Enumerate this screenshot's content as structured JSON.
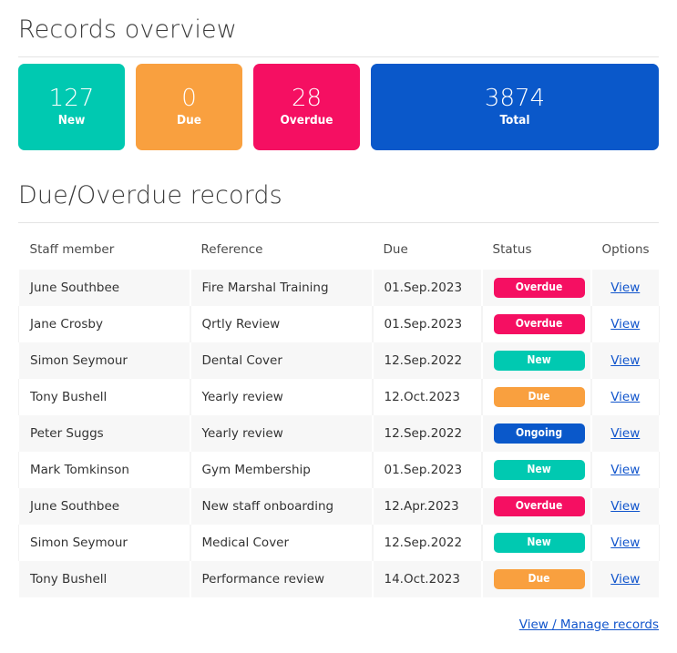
{
  "overview": {
    "title": "Records overview",
    "cards": [
      {
        "value": "127",
        "label": "New",
        "color": "#00c9b1",
        "size": "small"
      },
      {
        "value": "0",
        "label": "Due",
        "color": "#f9a03f",
        "size": "small"
      },
      {
        "value": "28",
        "label": "Overdue",
        "color": "#f50f62",
        "size": "small"
      },
      {
        "value": "3874",
        "label": "Total",
        "color": "#0a58ca",
        "size": "wide"
      }
    ]
  },
  "records_section": {
    "title": "Due/Overdue records",
    "columns": [
      "Staff member",
      "Reference",
      "Due",
      "Status",
      "Options"
    ],
    "action_label": "View",
    "rows": [
      {
        "staff": "June Southbee",
        "reference": "Fire Marshal Training",
        "due": "01.Sep.2023",
        "status": "Overdue",
        "status_color": "#f50f62",
        "action": "View"
      },
      {
        "staff": "Jane Crosby",
        "reference": "Qrtly Review",
        "due": "01.Sep.2023",
        "status": "Overdue",
        "status_color": "#f50f62",
        "action": "View"
      },
      {
        "staff": "Simon Seymour",
        "reference": "Dental Cover",
        "due": "12.Sep.2022",
        "status": "New",
        "status_color": "#00c9b1",
        "action": "View"
      },
      {
        "staff": "Tony Bushell",
        "reference": "Yearly review",
        "due": "12.Oct.2023",
        "status": "Due",
        "status_color": "#f9a03f",
        "action": "View"
      },
      {
        "staff": "Peter Suggs",
        "reference": "Yearly review",
        "due": "12.Sep.2022",
        "status": "Ongoing",
        "status_color": "#0a58ca",
        "action": "View"
      },
      {
        "staff": "Mark Tomkinson",
        "reference": "Gym Membership",
        "due": "01.Sep.2023",
        "status": "New",
        "status_color": "#00c9b1",
        "action": "View"
      },
      {
        "staff": "June Southbee",
        "reference": "New staff onboarding",
        "due": "12.Apr.2023",
        "status": "Overdue",
        "status_color": "#f50f62",
        "action": "View"
      },
      {
        "staff": "Simon Seymour",
        "reference": "Medical Cover",
        "due": "12.Sep.2022",
        "status": "New",
        "status_color": "#00c9b1",
        "action": "View"
      },
      {
        "staff": "Tony Bushell",
        "reference": "Performance review",
        "due": "14.Oct.2023",
        "status": "Due",
        "status_color": "#f9a03f",
        "action": "View"
      }
    ]
  },
  "footer": {
    "manage_link": "View / Manage records"
  }
}
